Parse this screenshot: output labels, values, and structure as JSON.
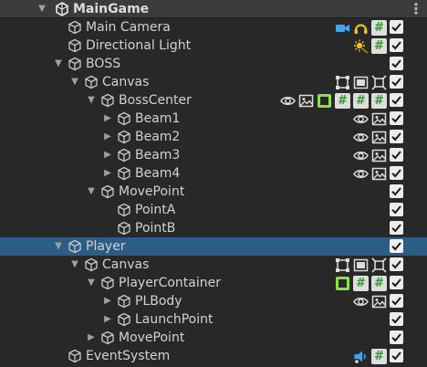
{
  "scene": {
    "name": "MainGame"
  },
  "rows": [
    {
      "label": "Main Camera",
      "depth": 1,
      "arrow": "",
      "icons": [
        "camera-icon",
        "audio-listener-icon",
        "script-icon"
      ]
    },
    {
      "label": "Directional Light",
      "depth": 1,
      "arrow": "",
      "icons": [
        "light-icon",
        "script-icon"
      ]
    },
    {
      "label": "BOSS",
      "depth": 1,
      "arrow": "expanded",
      "icons": []
    },
    {
      "label": "Canvas",
      "depth": 2,
      "arrow": "expanded",
      "icons": [
        "rect-transform-icon",
        "canvas-icon",
        "canvas-scaler-icon"
      ]
    },
    {
      "label": "BossCenter",
      "depth": 3,
      "arrow": "expanded",
      "icons": [
        "eye-icon",
        "image-icon",
        "green-frame-icon",
        "script-icon",
        "script-icon",
        "script-icon"
      ]
    },
    {
      "label": "Beam1",
      "depth": 4,
      "arrow": "collapsed",
      "icons": [
        "eye-icon",
        "image-icon"
      ]
    },
    {
      "label": "Beam2",
      "depth": 4,
      "arrow": "collapsed",
      "icons": [
        "eye-icon",
        "image-icon"
      ]
    },
    {
      "label": "Beam3",
      "depth": 4,
      "arrow": "collapsed",
      "icons": [
        "eye-icon",
        "image-icon"
      ]
    },
    {
      "label": "Beam4",
      "depth": 4,
      "arrow": "collapsed",
      "icons": [
        "eye-icon",
        "image-icon"
      ]
    },
    {
      "label": "MovePoint",
      "depth": 3,
      "arrow": "expanded",
      "icons": []
    },
    {
      "label": "PointA",
      "depth": 4,
      "arrow": "",
      "icons": []
    },
    {
      "label": "PointB",
      "depth": 4,
      "arrow": "",
      "icons": []
    },
    {
      "label": "Player",
      "depth": 1,
      "arrow": "expanded",
      "icons": [],
      "selected": true
    },
    {
      "label": "Canvas",
      "depth": 2,
      "arrow": "expanded",
      "icons": [
        "rect-transform-icon",
        "canvas-icon",
        "canvas-scaler-icon"
      ]
    },
    {
      "label": "PlayerContainer",
      "depth": 3,
      "arrow": "expanded",
      "icons": [
        "green-frame-icon",
        "script-icon",
        "script-icon"
      ]
    },
    {
      "label": "PLBody",
      "depth": 4,
      "arrow": "collapsed",
      "icons": [
        "eye-icon",
        "image-icon"
      ]
    },
    {
      "label": "LaunchPoint",
      "depth": 4,
      "arrow": "collapsed",
      "icons": []
    },
    {
      "label": "MovePoint",
      "depth": 3,
      "arrow": "collapsed",
      "icons": []
    },
    {
      "label": "EventSystem",
      "depth": 1,
      "arrow": "",
      "icons": [
        "event-system-icon",
        "script-icon"
      ]
    }
  ],
  "script_glyph": "#",
  "kebab_glyph": "⋮",
  "colors": {
    "background": "#282828",
    "scene_header": "#3b3b3b",
    "selection": "#2c5d87",
    "text": "#d2d2d2",
    "script_hash": "#2f9a2f",
    "camera_blue": "#3da8f0",
    "audio_yellow": "#f0c020",
    "green_frame": "#8ee04a"
  }
}
